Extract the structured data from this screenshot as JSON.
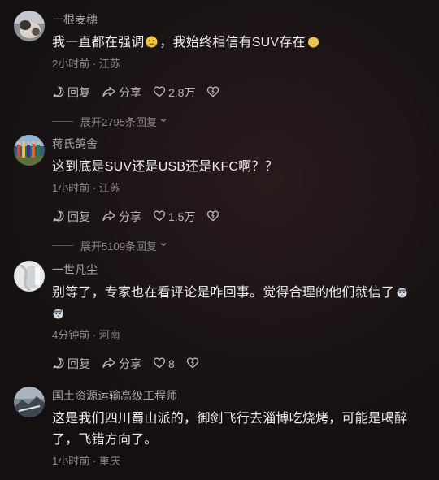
{
  "comments": [
    {
      "username": "一根麦穗",
      "text_before": "我一直都在强调",
      "text_mid": "，我始终相信有SUV存在",
      "time": "2小时前",
      "location": "江苏",
      "reply_label": "回复",
      "share_label": "分享",
      "likes": "2.8万",
      "expand_label": "展开2795条回复"
    },
    {
      "username": "蒋氏鸽舍",
      "text": "这到底是SUV还是USB还是KFC啊？？",
      "time": "1小时前",
      "location": "江苏",
      "reply_label": "回复",
      "share_label": "分享",
      "likes": "1.5万",
      "expand_label": "展开5109条回复"
    },
    {
      "username": "一世凡尘",
      "text": "别等了，专家也在看评论是咋回事。觉得合理的他们就信了",
      "time": "4分钟前",
      "location": "河南",
      "reply_label": "回复",
      "share_label": "分享",
      "likes": "8"
    },
    {
      "username": "国土资源运输高级工程师",
      "text": "这是我们四川蜀山派的，御剑飞行去淄博吃烧烤，可能是喝醉了，飞错方向了。",
      "time": "1小时前",
      "location": "重庆"
    }
  ],
  "separator": " · ",
  "colors": {
    "background": "#161213",
    "text_primary": "#EDEDED",
    "text_secondary": "#8E8C8D",
    "username": "#A8A6A7"
  },
  "icons": [
    "comment-icon",
    "share-icon",
    "heart-icon",
    "dislike-icon",
    "chevron-down-icon",
    "thinking-emoji-icon",
    "cat-emoji-icon"
  ]
}
